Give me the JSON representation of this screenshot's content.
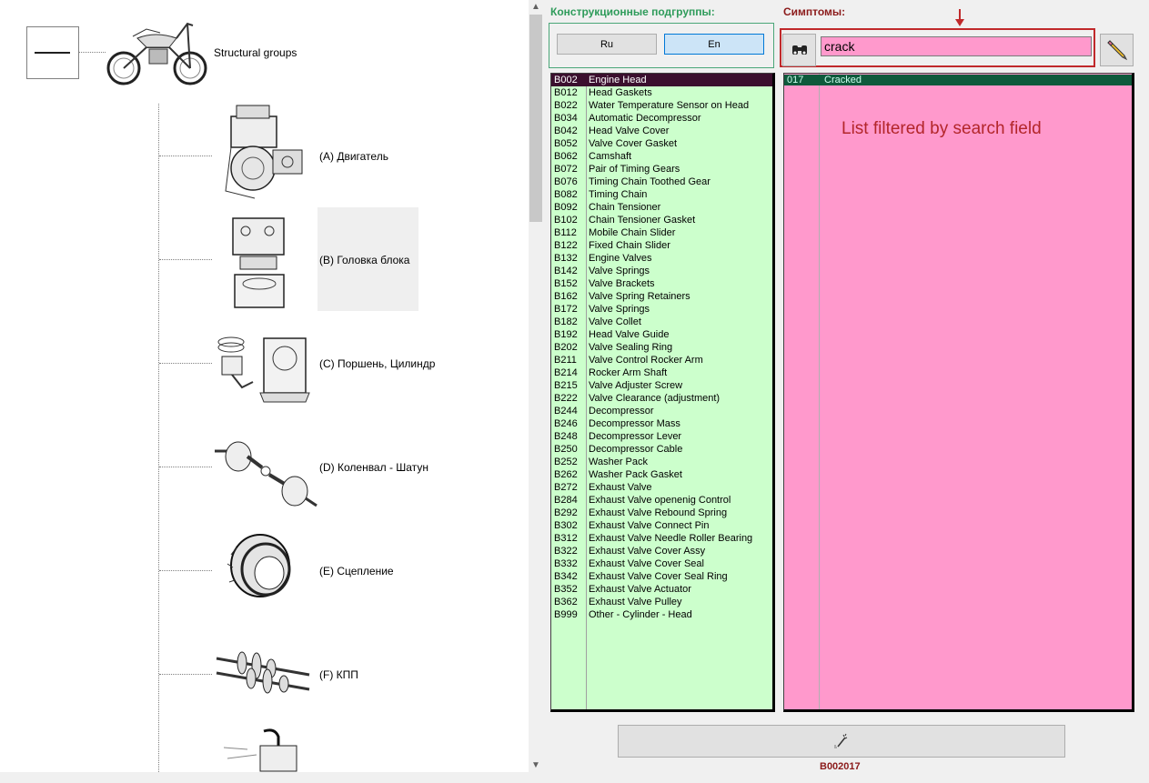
{
  "tree": {
    "root_label": "Structural groups",
    "nodes": [
      {
        "label": "(A) Двигатель",
        "icon": "engine-image"
      },
      {
        "label": "(B) Головка блока",
        "icon": "cylinder-head-image"
      },
      {
        "label": "(C) Поршень, Цилиндр",
        "icon": "piston-cylinder-image"
      },
      {
        "label": "(D) Коленвал - Шатун",
        "icon": "crankshaft-image"
      },
      {
        "label": "(E) Сцепление",
        "icon": "clutch-image"
      },
      {
        "label": "(F) КПП",
        "icon": "gearbox-image"
      }
    ]
  },
  "groups": {
    "header": "Конструкционные подгруппы:",
    "lang_ru": "Ru",
    "lang_en": "En",
    "selected_code": "B002",
    "items": [
      {
        "code": "B002",
        "name": "Engine Head"
      },
      {
        "code": "B012",
        "name": "Head Gaskets"
      },
      {
        "code": "B022",
        "name": "Water Temperature Sensor on Head"
      },
      {
        "code": "B034",
        "name": "Automatic Decompressor"
      },
      {
        "code": "B042",
        "name": "Head Valve Cover"
      },
      {
        "code": "B052",
        "name": "Valve Cover Gasket"
      },
      {
        "code": "B062",
        "name": "Camshaft"
      },
      {
        "code": "B072",
        "name": "Pair of Timing Gears"
      },
      {
        "code": "B076",
        "name": "Timing Chain Toothed Gear"
      },
      {
        "code": "B082",
        "name": "Timing Chain"
      },
      {
        "code": "B092",
        "name": "Chain Tensioner"
      },
      {
        "code": "B102",
        "name": "Chain Tensioner Gasket"
      },
      {
        "code": "B112",
        "name": "Mobile Chain Slider"
      },
      {
        "code": "B122",
        "name": "Fixed Chain Slider"
      },
      {
        "code": "B132",
        "name": "Engine Valves"
      },
      {
        "code": "B142",
        "name": "Valve Springs"
      },
      {
        "code": "B152",
        "name": "Valve Brackets"
      },
      {
        "code": "B162",
        "name": "Valve Spring Retainers"
      },
      {
        "code": "B172",
        "name": "Valve Springs"
      },
      {
        "code": "B182",
        "name": "Valve Collet"
      },
      {
        "code": "B192",
        "name": "Head Valve Guide"
      },
      {
        "code": "B202",
        "name": "Valve Sealing Ring"
      },
      {
        "code": "B211",
        "name": "Valve Control Rocker Arm"
      },
      {
        "code": "B214",
        "name": "Rocker Arm Shaft"
      },
      {
        "code": "B215",
        "name": "Valve Adjuster Screw"
      },
      {
        "code": "B222",
        "name": "Valve Clearance (adjustment)"
      },
      {
        "code": "B244",
        "name": "Decompressor"
      },
      {
        "code": "B246",
        "name": "Decompressor Mass"
      },
      {
        "code": "B248",
        "name": "Decompressor Lever"
      },
      {
        "code": "B250",
        "name": "Decompressor Cable"
      },
      {
        "code": "B252",
        "name": "Washer Pack"
      },
      {
        "code": "B262",
        "name": "Washer Pack Gasket"
      },
      {
        "code": "B272",
        "name": "Exhaust Valve"
      },
      {
        "code": "B284",
        "name": "Exhaust Valve openenig Control"
      },
      {
        "code": "B292",
        "name": "Exhaust Valve Rebound Spring"
      },
      {
        "code": "B302",
        "name": "Exhaust Valve Connect Pin"
      },
      {
        "code": "B312",
        "name": "Exhaust Valve Needle Roller Bearing"
      },
      {
        "code": "B322",
        "name": "Exhaust Valve Cover Assy"
      },
      {
        "code": "B332",
        "name": "Exhaust Valve Cover Seal"
      },
      {
        "code": "B342",
        "name": "Exhaust Valve Cover Seal Ring"
      },
      {
        "code": "B352",
        "name": "Exhaust Valve Actuator"
      },
      {
        "code": "B362",
        "name": "Exhaust Valve Pulley"
      },
      {
        "code": "B999",
        "name": "Other - Cylinder - Head"
      }
    ]
  },
  "symptoms": {
    "header": "Симптомы:",
    "search_value": "crack",
    "items": [
      {
        "code": "017",
        "name": "Cracked"
      }
    ],
    "annotation": "List filtered by search field"
  },
  "result_code": "B002017",
  "colors": {
    "groups_bg": "#ccffcc",
    "symptoms_bg": "#ff99cc",
    "groups_header": "#2e9b5a",
    "symptoms_header": "#8b1a1a",
    "annotation": "#b3262a"
  }
}
